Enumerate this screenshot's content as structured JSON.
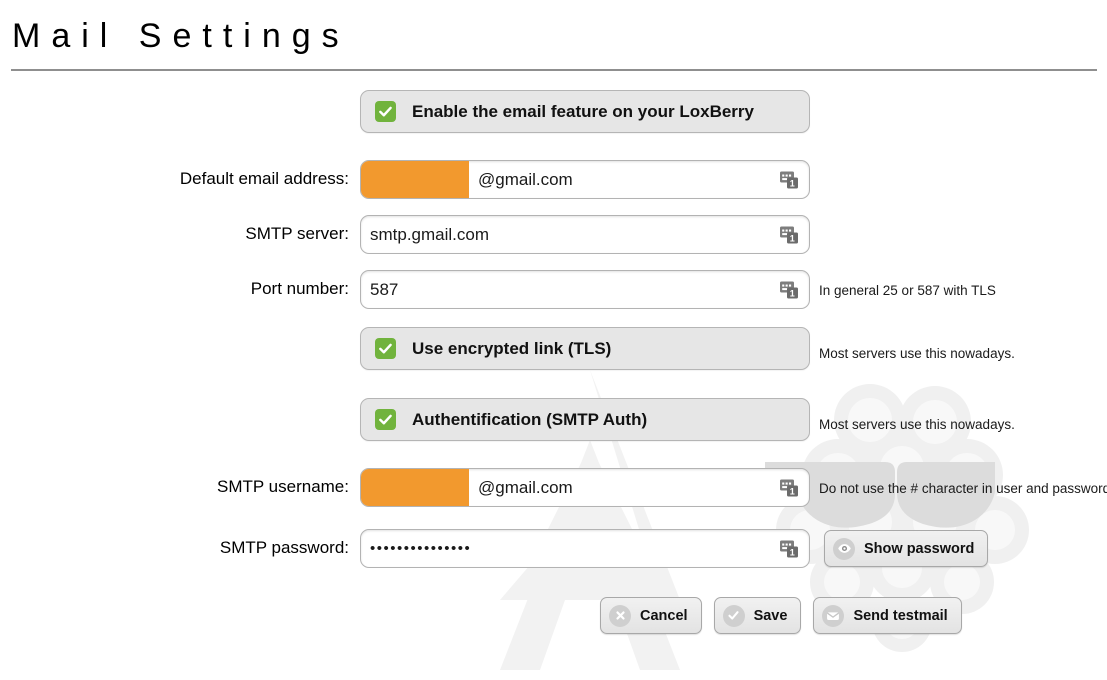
{
  "page": {
    "title": "Mail Settings"
  },
  "form": {
    "enable_feature": {
      "label": "Enable the email feature on your LoxBerry",
      "checked": true,
      "icon": "checkbox-checked-icon"
    },
    "default_email": {
      "label": "Default email address:",
      "value": "@gmail.com",
      "redacted": true,
      "field_icon": "1password-autofill-icon"
    },
    "smtp_server": {
      "label": "SMTP server:",
      "value": "smtp.gmail.com",
      "field_icon": "1password-autofill-icon"
    },
    "port_number": {
      "label": "Port number:",
      "value": "587",
      "hint": "In general 25 or 587 with TLS",
      "field_icon": "1password-autofill-icon"
    },
    "tls": {
      "label": "Use encrypted link (TLS)",
      "checked": true,
      "hint": "Most servers use this nowadays.",
      "icon": "checkbox-checked-icon"
    },
    "auth": {
      "label": "Authentification (SMTP Auth)",
      "checked": true,
      "hint": "Most servers use this nowadays.",
      "icon": "checkbox-checked-icon"
    },
    "smtp_username": {
      "label": "SMTP username:",
      "value": "@gmail.com",
      "redacted": true,
      "hint": "Do not use the # character in user and password",
      "field_icon": "1password-autofill-icon"
    },
    "smtp_password": {
      "label": "SMTP password:",
      "value": "•••••••••••••••",
      "field_icon": "1password-autofill-icon"
    }
  },
  "actions": {
    "show_password": {
      "label": "Show password",
      "icon": "eye-icon"
    },
    "cancel": {
      "label": "Cancel",
      "icon": "x-circle-icon"
    },
    "save": {
      "label": "Save",
      "icon": "check-circle-icon"
    },
    "send_testmail": {
      "label": "Send testmail",
      "icon": "envelope-icon"
    }
  },
  "colors": {
    "checkbox_green": "#71b33d",
    "redaction_orange": "#f2992e",
    "row_grey": "#e6e6e6",
    "border_grey": "#b3b3b3",
    "rule_grey": "#8f8f8f"
  }
}
